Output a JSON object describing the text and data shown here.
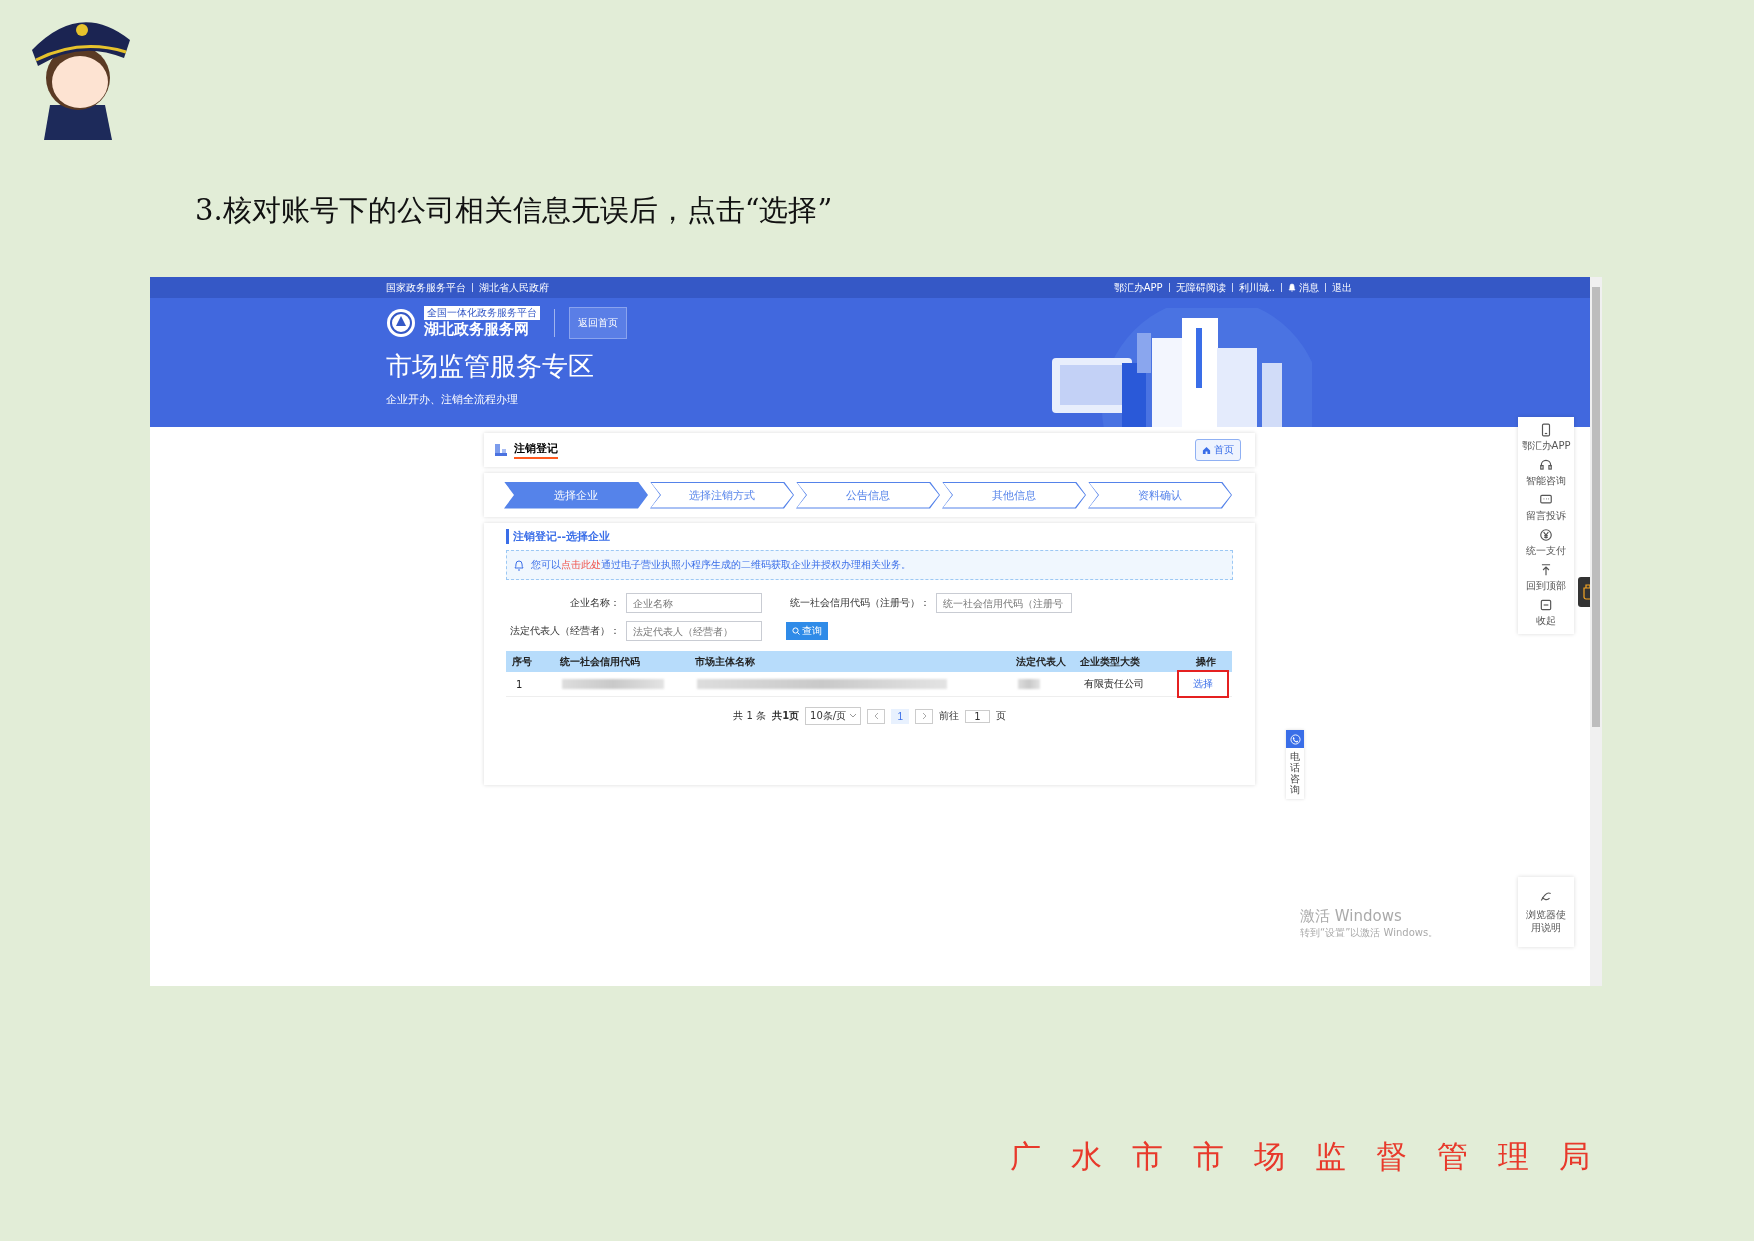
{
  "heading": "3.核对账号下的公司相关信息无误后，点击“选择”",
  "screen": {
    "top_bar": {
      "left": [
        "国家政务服务平台",
        "湖北省人民政府"
      ],
      "right": [
        {
          "label": "鄂汇办APP",
          "kind": "text"
        },
        {
          "label": "无障碍阅读",
          "kind": "text"
        },
        {
          "label": "利川城..",
          "kind": "text"
        },
        {
          "label": "消息",
          "kind": "bell"
        },
        {
          "label": "退出",
          "kind": "text"
        }
      ]
    },
    "banner": {
      "logo_top": "全国一体化政务服务平台",
      "logo_name": "湖北政务服务网",
      "back_button": "返回首页",
      "title": "市场监管服务专区",
      "subtitle": "企业开办、注销全流程办理"
    },
    "page_header": {
      "title": "注销登记",
      "home_button": "首页"
    },
    "steps": [
      {
        "label": "选择企业",
        "selected": true
      },
      {
        "label": "选择注销方式",
        "selected": false
      },
      {
        "label": "公告信息",
        "selected": false
      },
      {
        "label": "其他信息",
        "selected": false
      },
      {
        "label": "资料确认",
        "selected": false
      }
    ],
    "section_title": "注销登记--选择企业",
    "notice": {
      "before": "您可以",
      "link": "点击此处",
      "after": "通过电子营业执照小程序生成的二维码获取企业并授权办理相关业务。"
    },
    "filters": [
      {
        "label": "企业名称：",
        "placeholder": "企业名称"
      },
      {
        "label": "统一社会信用代码（注册号）：",
        "placeholder": "统一社会信用代码（注册号"
      },
      {
        "label": "法定代表人（经营者）：",
        "placeholder": "法定代表人（经营者）"
      }
    ],
    "search_button": "查询",
    "table": {
      "columns": [
        "序号",
        "统一社会信用代码",
        "市场主体名称",
        "法定代表人",
        "企业类型大类",
        "操作"
      ],
      "rows": [
        {
          "cells": [
            {
              "kind": "text",
              "text": "1"
            },
            {
              "kind": "redacted"
            },
            {
              "kind": "redacted"
            },
            {
              "kind": "redacted"
            },
            {
              "kind": "text",
              "text": "有限责任公司"
            },
            {
              "kind": "action",
              "text": "选择",
              "highlighted": true
            }
          ]
        }
      ]
    },
    "pagination": {
      "total": "共 1 条",
      "pages": "共1页",
      "page_size": "10条/页",
      "current": "1",
      "goto_label": "前往",
      "goto_value": "1",
      "goto_suffix": "页"
    },
    "side_tools": [
      {
        "label": "鄂汇办APP",
        "kind": "phone"
      },
      {
        "label": "智能咨询",
        "kind": "headset"
      },
      {
        "label": "留言投诉",
        "kind": "message"
      },
      {
        "label": "统一支付",
        "kind": "yuan"
      },
      {
        "label": "回到顶部",
        "kind": "top"
      },
      {
        "label": "收起",
        "kind": "collapse"
      }
    ],
    "phone_tab": "电话咨询",
    "browser_help": "浏览器使用说明",
    "windows_notice": {
      "title": "激活 Windows",
      "hint": "转到“设置”以激活 Windows。"
    }
  },
  "footer": "广水市市场监督管理局"
}
